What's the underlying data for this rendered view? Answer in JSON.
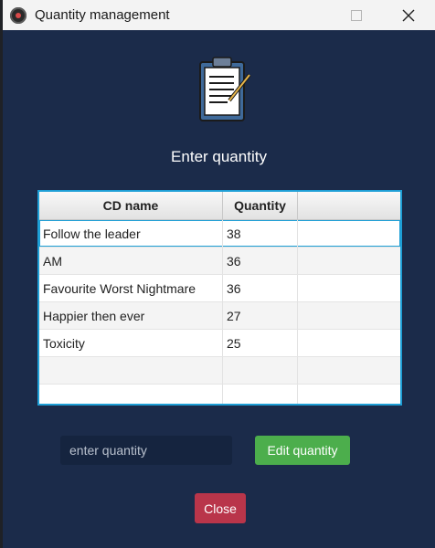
{
  "window": {
    "title": "Quantity management"
  },
  "heading": "Enter quantity",
  "table": {
    "columns": [
      "CD name",
      "Quantity",
      ""
    ],
    "rows": [
      {
        "name": "Follow the leader",
        "quantity": "38"
      },
      {
        "name": "AM",
        "quantity": "36"
      },
      {
        "name": "Favourite Worst Nightmare",
        "quantity": "36"
      },
      {
        "name": "Happier then ever",
        "quantity": "27"
      },
      {
        "name": "Toxicity",
        "quantity": "25"
      }
    ],
    "selected_row": 0
  },
  "form": {
    "quantity_placeholder": "enter quantity",
    "edit_label": "Edit quantity",
    "close_label": "Close"
  },
  "colors": {
    "window_bg": "#1b2b4a",
    "edit_button": "#4cae4c",
    "close_button": "#b9354a",
    "table_border": "#1e9fd6"
  },
  "icons": {
    "app": "vinyl-record-icon",
    "logo": "clipboard-list-icon",
    "maximize": "maximize-icon",
    "close_window": "close-icon"
  }
}
